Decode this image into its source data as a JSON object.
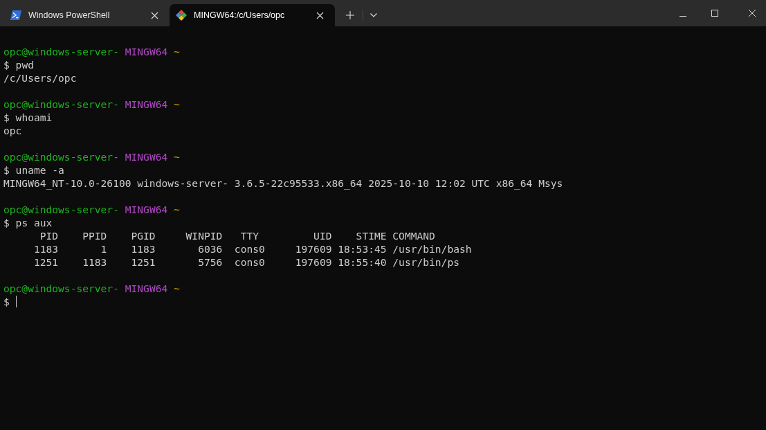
{
  "tabs": [
    {
      "title": "Windows PowerShell",
      "kind": "powershell",
      "selected": false
    },
    {
      "title": "MINGW64:/c/Users/opc",
      "kind": "git",
      "selected": true
    }
  ],
  "terminal": {
    "lines": [
      {
        "kind": "prompt",
        "user": "opc@windows-server-",
        "system": "MINGW64",
        "path": "~"
      },
      {
        "kind": "command",
        "prompt": "$",
        "text": "pwd"
      },
      {
        "kind": "output",
        "text": "/c/Users/opc"
      },
      {
        "kind": "blank"
      },
      {
        "kind": "prompt",
        "user": "opc@windows-server-",
        "system": "MINGW64",
        "path": "~"
      },
      {
        "kind": "command",
        "prompt": "$",
        "text": "whoami"
      },
      {
        "kind": "output",
        "text": "opc"
      },
      {
        "kind": "blank"
      },
      {
        "kind": "prompt",
        "user": "opc@windows-server-",
        "system": "MINGW64",
        "path": "~"
      },
      {
        "kind": "command",
        "prompt": "$",
        "text": "uname -a"
      },
      {
        "kind": "output",
        "text": "MINGW64_NT-10.0-26100 windows-server- 3.6.5-22c95533.x86_64 2025-10-10 12:02 UTC x86_64 Msys"
      },
      {
        "kind": "blank"
      },
      {
        "kind": "prompt",
        "user": "opc@windows-server-",
        "system": "MINGW64",
        "path": "~"
      },
      {
        "kind": "command",
        "prompt": "$",
        "text": "ps aux"
      },
      {
        "kind": "output",
        "text": "      PID    PPID    PGID     WINPID   TTY         UID    STIME COMMAND"
      },
      {
        "kind": "output",
        "text": "     1183       1    1183       6036  cons0     197609 18:53:45 /usr/bin/bash"
      },
      {
        "kind": "output",
        "text": "     1251    1183    1251       5756  cons0     197609 18:55:40 /usr/bin/ps"
      },
      {
        "kind": "blank"
      },
      {
        "kind": "prompt",
        "user": "opc@windows-server-",
        "system": "MINGW64",
        "path": "~"
      },
      {
        "kind": "input",
        "prompt": "$"
      }
    ]
  }
}
